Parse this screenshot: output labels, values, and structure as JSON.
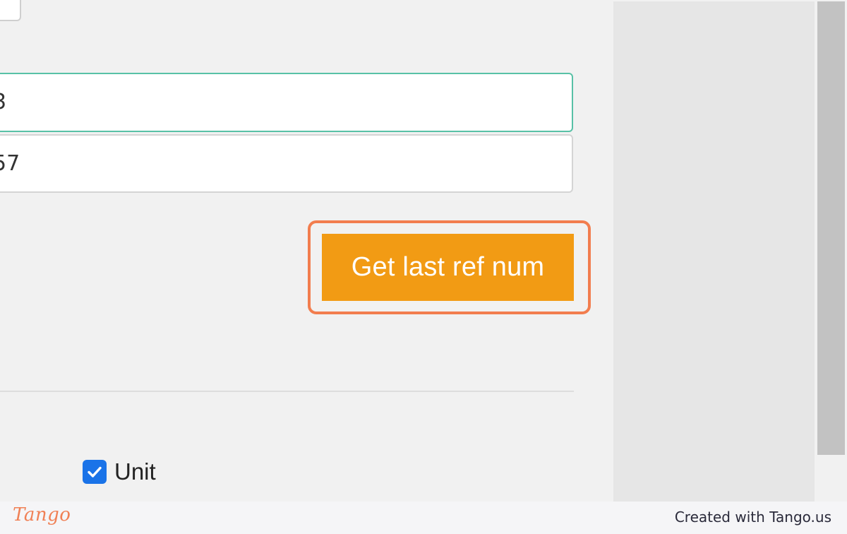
{
  "form": {
    "field_1_value": "3",
    "field_2_value": "57",
    "get_ref_button_label": "Get last ref num",
    "unit_checkbox_label": "Unit",
    "unit_checked": true
  },
  "footer": {
    "logo_text": "Tango",
    "credit_text": "Created with Tango.us"
  },
  "colors": {
    "button_bg": "#f29b14",
    "highlight_border": "#f27d4e",
    "focus_border": "#58c1a6",
    "checkbox_bg": "#1a73e8"
  },
  "icons": {
    "checkbox_mark": "checkmark-icon"
  }
}
